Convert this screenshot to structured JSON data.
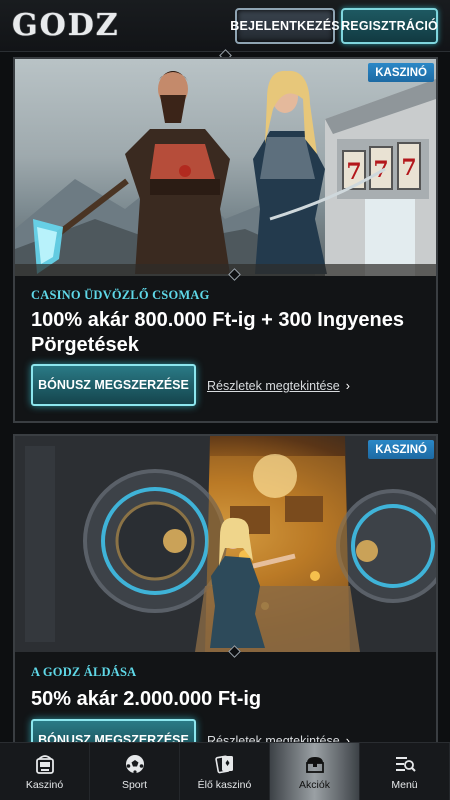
{
  "header": {
    "logo": "GODZ",
    "login_label": "BEJELENTKEZÉS",
    "register_label": "REGISZTRÁCIÓ"
  },
  "promos": [
    {
      "badge": "KASZINÓ",
      "kicker": "CASINO ÜDVÖZLŐ CSOMAG",
      "title": "100% akár 800.000 Ft-ig + 300 Ingyenes Pörgetések",
      "cta": "BÓNUSZ MEGSZERZÉSE",
      "details": "Részletek megtekintése",
      "slot_digits": [
        "7",
        "7",
        "7"
      ]
    },
    {
      "badge": "KASZINÓ",
      "kicker": "A GODZ ÁLDÁSA",
      "title": "50% akár 2.000.000 Ft-ig",
      "cta": "BÓNUSZ MEGSZERZÉSE",
      "details": "Részletek megtekintése"
    }
  ],
  "nav": {
    "items": [
      {
        "label": "Kaszinó",
        "icon": "casino-icon"
      },
      {
        "label": "Sport",
        "icon": "soccer-ball-icon"
      },
      {
        "label": "Élő kaszinó",
        "icon": "cards-icon"
      },
      {
        "label": "Akciók",
        "icon": "treasure-chest-icon",
        "active": true
      },
      {
        "label": "Menü",
        "icon": "menu-search-icon"
      }
    ]
  },
  "colors": {
    "accent_cyan": "#5fd8e8",
    "badge_blue": "#2b88c7",
    "card_bg": "#121416"
  }
}
